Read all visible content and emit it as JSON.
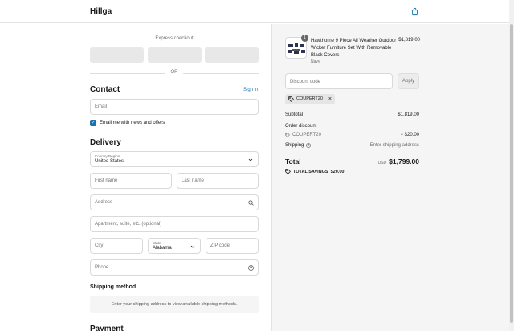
{
  "header": {
    "brand": "Hillga",
    "bag_icon": "shopping-bag-icon"
  },
  "express": {
    "label": "Express checkout",
    "or_label": "OR"
  },
  "contact": {
    "title": "Contact",
    "sign_in_label": "Sign in",
    "email_placeholder": "Email",
    "newsletter_label": "Email me with news and offers",
    "newsletter_checked": true
  },
  "delivery": {
    "title": "Delivery",
    "country_label": "Country/Region",
    "country_value": "United States",
    "first_name_placeholder": "First name",
    "last_name_placeholder": "Last name",
    "address_placeholder": "Address",
    "apartment_placeholder": "Apartment, suite, etc. (optional)",
    "city_placeholder": "City",
    "state_label": "State",
    "state_value": "Alabama",
    "zip_placeholder": "ZIP code",
    "phone_placeholder": "Phone"
  },
  "shipping_method": {
    "title": "Shipping method",
    "notice": "Enter your shipping address to view available shipping methods."
  },
  "payment": {
    "title": "Payment"
  },
  "summary": {
    "product": {
      "name": "Hawthorne 9 Piece All Weather Outdoor Wicker Furniture Set With Removable Black Covers",
      "variant": "Navy",
      "price": "$1,819.00",
      "quantity": "1"
    },
    "discount_placeholder": "Discount code",
    "apply_label": "Apply",
    "applied_code": "COUPERT20",
    "subtotal_label": "Subtotal",
    "subtotal_value": "$1,819.00",
    "order_discount_label": "Order discount",
    "discount_code_line": "COUPERT20",
    "discount_amount": "− $20.00",
    "shipping_label": "Shipping",
    "shipping_value": "Enter shipping address",
    "total_label": "Total",
    "currency": "USD",
    "total_value": "$1,799.00",
    "savings_label": "TOTAL SAVINGS",
    "savings_value": "$20.00"
  },
  "colors": {
    "accent": "#1773b0",
    "panel_bg": "#f5f5f5"
  }
}
